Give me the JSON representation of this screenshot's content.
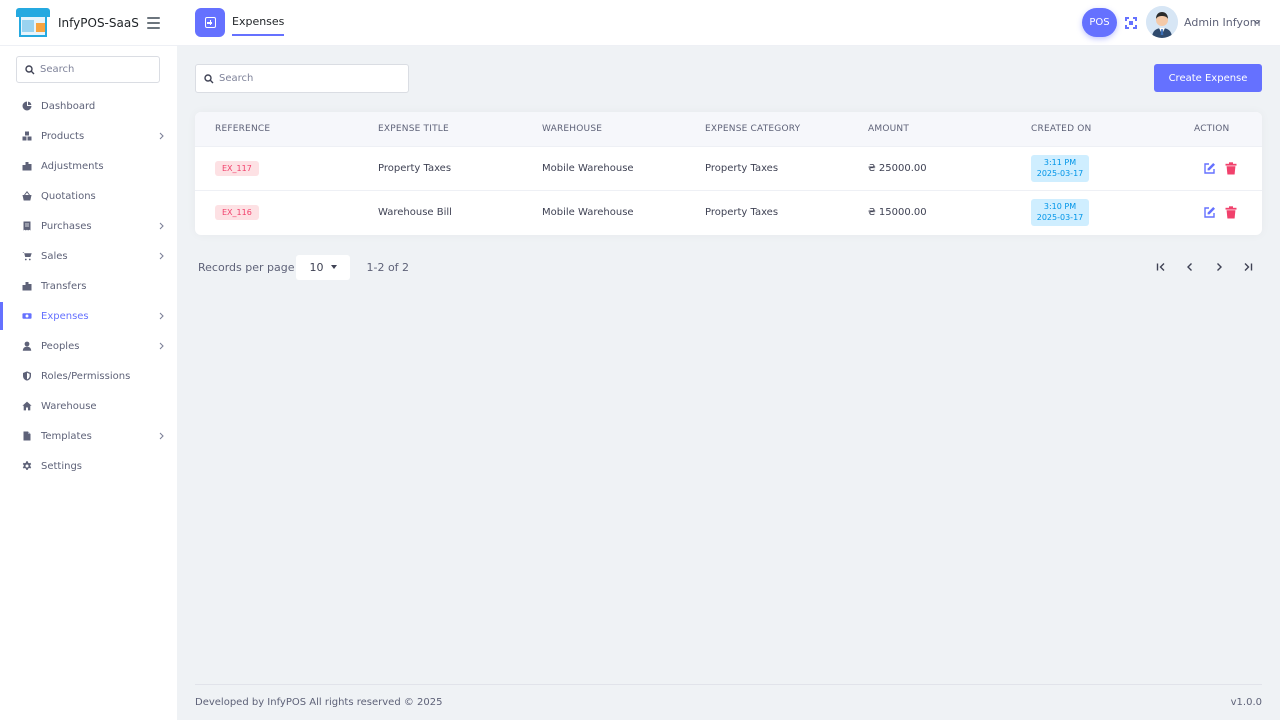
{
  "app": {
    "name": "InfyPOS-SaaS"
  },
  "header": {
    "page_tab": "Expenses",
    "pos_label": "POS",
    "user_name": "Admin Infyom"
  },
  "sidebar": {
    "search_placeholder": "Search",
    "items": [
      {
        "label": "Dashboard",
        "icon": "dashboard-icon",
        "has_submenu": false
      },
      {
        "label": "Products",
        "icon": "boxes-icon",
        "has_submenu": true
      },
      {
        "label": "Adjustments",
        "icon": "adjustments-icon",
        "has_submenu": false
      },
      {
        "label": "Quotations",
        "icon": "basket-icon",
        "has_submenu": false
      },
      {
        "label": "Purchases",
        "icon": "receipt-icon",
        "has_submenu": true
      },
      {
        "label": "Sales",
        "icon": "cart-icon",
        "has_submenu": true
      },
      {
        "label": "Transfers",
        "icon": "transfer-icon",
        "has_submenu": false
      },
      {
        "label": "Expenses",
        "icon": "money-icon",
        "has_submenu": true,
        "active": true
      },
      {
        "label": "Peoples",
        "icon": "user-icon",
        "has_submenu": true
      },
      {
        "label": "Roles/Permissions",
        "icon": "shield-icon",
        "has_submenu": false
      },
      {
        "label": "Warehouse",
        "icon": "home-icon",
        "has_submenu": false
      },
      {
        "label": "Templates",
        "icon": "file-icon",
        "has_submenu": true
      },
      {
        "label": "Settings",
        "icon": "gear-icon",
        "has_submenu": false
      }
    ]
  },
  "main": {
    "search_placeholder": "Search",
    "create_button": "Create Expense",
    "table": {
      "columns": [
        "REFERENCE",
        "EXPENSE TITLE",
        "WAREHOUSE",
        "EXPENSE CATEGORY",
        "AMOUNT",
        "CREATED ON",
        "ACTION"
      ],
      "rows": [
        {
          "reference": "EX_117",
          "title": "Property Taxes",
          "warehouse": "Mobile Warehouse",
          "category": "Property Taxes",
          "amount": "₴ 25000.00",
          "time": "3:11 PM",
          "date": "2025-03-17"
        },
        {
          "reference": "EX_116",
          "title": "Warehouse Bill",
          "warehouse": "Mobile Warehouse",
          "category": "Property Taxes",
          "amount": "₴ 15000.00",
          "time": "3:10 PM",
          "date": "2025-03-17"
        }
      ]
    },
    "pagination": {
      "records_label": "Records per page",
      "per_page": "10",
      "range": "1-2 of 2"
    }
  },
  "footer": {
    "text": "Developed by InfyPOS All rights reserved © 2025",
    "version": "v1.0.0"
  },
  "colors": {
    "accent": "#6571ff",
    "danger": "#f1416c",
    "info": "#0095e8"
  }
}
